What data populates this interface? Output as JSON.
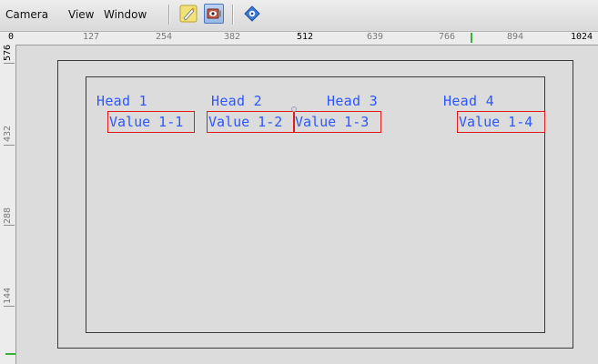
{
  "menu": {
    "items": [
      "Camera",
      "View",
      "Window"
    ]
  },
  "toolbar": {
    "tools": [
      {
        "icon": "pencil-wand-icon",
        "active": false
      },
      {
        "icon": "camera-eye-icon",
        "active": true
      },
      {
        "icon": "view-compass-icon",
        "active": false
      }
    ]
  },
  "rulers": {
    "horizontal": [
      "0",
      "127",
      "254",
      "382",
      "512",
      "639",
      "766",
      "894",
      "1024"
    ],
    "vertical": [
      "576",
      "432",
      "288",
      "144"
    ]
  },
  "table": {
    "headers": [
      "Head 1",
      "Head 2",
      "Head 3",
      "Head 4"
    ],
    "values": [
      "Value 1-1",
      "Value 1-2",
      "Value 1-3",
      "Value 1-4"
    ]
  },
  "colors": {
    "text": "#2d57ff",
    "selection": "#e01a1a",
    "marker": "#36b336"
  }
}
